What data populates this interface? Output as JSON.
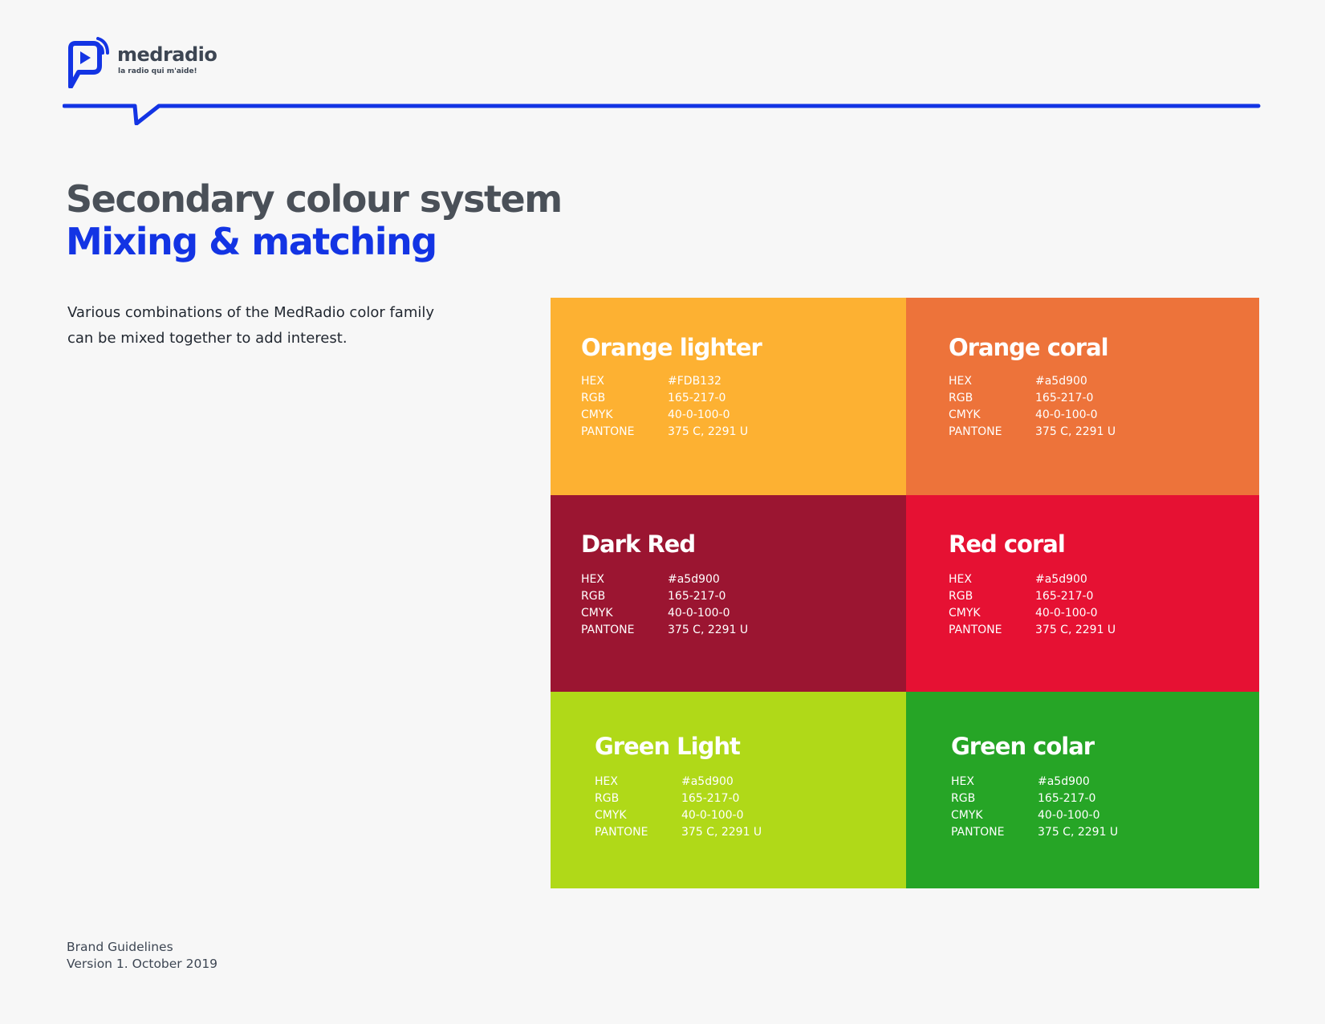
{
  "brand": {
    "name": "medradio",
    "tagline": "la radio qui m'aide!",
    "accent_color": "#1334e4",
    "icon": "play-speech-bubble-icon"
  },
  "page": {
    "title": "Secondary colour system",
    "subtitle": "Mixing & matching",
    "description": "Various combinations of the MedRadio color family can be mixed together to add interest."
  },
  "spec_labels": {
    "hex": "HEX",
    "rgb": "RGB",
    "cmyk": "CMYK",
    "pantone": "PANTONE"
  },
  "swatches": [
    {
      "name": "Orange lighter",
      "color": "#fdb132",
      "hex": "#FDB132",
      "rgb": "165-217-0",
      "cmyk": "40-0-100-0",
      "pantone": "375 C, 2291 U"
    },
    {
      "name": "Orange coral",
      "color": "#ed733a",
      "hex": "#a5d900",
      "rgb": "165-217-0",
      "cmyk": "40-0-100-0",
      "pantone": "375 C, 2291 U"
    },
    {
      "name": "Dark Red",
      "color": "#9b1531",
      "hex": "#a5d900",
      "rgb": "165-217-0",
      "cmyk": "40-0-100-0",
      "pantone": "375 C, 2291 U"
    },
    {
      "name": "Red coral",
      "color": "#e61133",
      "hex": "#a5d900",
      "rgb": "165-217-0",
      "cmyk": "40-0-100-0",
      "pantone": "375 C, 2291 U"
    },
    {
      "name": "Green Light",
      "color": "#b0d918",
      "hex": "#a5d900",
      "rgb": "165-217-0",
      "cmyk": "40-0-100-0",
      "pantone": "375 C, 2291 U"
    },
    {
      "name": "Green colar",
      "color": "#26a526",
      "hex": "#a5d900",
      "rgb": "165-217-0",
      "cmyk": "40-0-100-0",
      "pantone": "375 C, 2291 U"
    }
  ],
  "footer": {
    "line1": "Brand Guidelines",
    "line2": "Version 1. October 2019"
  }
}
